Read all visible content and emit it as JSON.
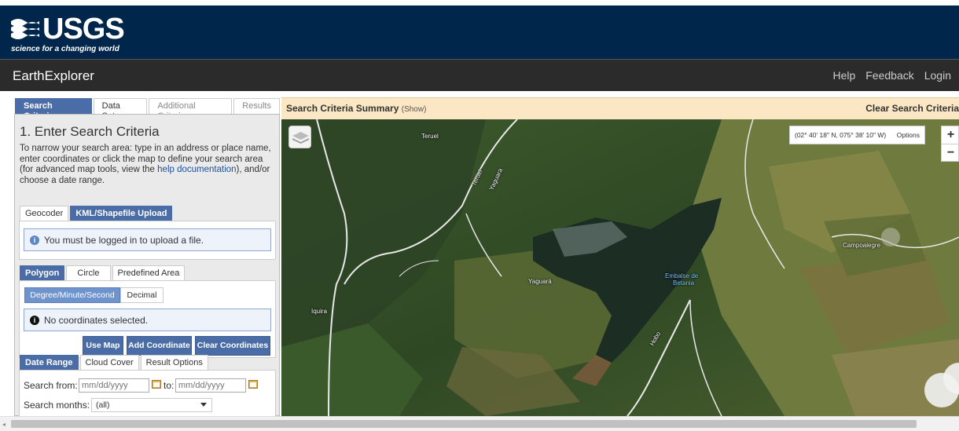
{
  "header": {
    "logo_word": "USGS",
    "logo_tagline": "science for a changing world",
    "app_title": "EarthExplorer",
    "nav_links": [
      "Help",
      "Feedback",
      "Login"
    ]
  },
  "main_tabs": [
    "Search Criteria",
    "Data Sets",
    "Additional Criteria",
    "Results"
  ],
  "search": {
    "heading": "1. Enter Search Criteria",
    "intro_before_link": "To narrow your search area: type in an address or place name, enter coordinates or click the map to define your search area (for advanced map tools, view the ",
    "intro_link": "help documentation",
    "intro_after_link": "), and/or choose a date range."
  },
  "geocoder_tabs": [
    "Geocoder",
    "KML/Shapefile Upload"
  ],
  "upload_message": "You must be logged in to upload a file.",
  "shape_tabs": [
    "Polygon",
    "Circle",
    "Predefined Area"
  ],
  "coord_format": [
    "Degree/Minute/Second",
    "Decimal"
  ],
  "coords_message": "No coordinates selected.",
  "coord_buttons": [
    "Use Map",
    "Add Coordinate",
    "Clear Coordinates"
  ],
  "date_tabs": [
    "Date Range",
    "Cloud Cover",
    "Result Options"
  ],
  "date_range": {
    "from_label": "Search from:",
    "from_placeholder": "mm/dd/yyyy",
    "to_label": "to:",
    "to_placeholder": "mm/dd/yyyy",
    "months_label": "Search months:",
    "months_value": "(all)"
  },
  "summary": {
    "title": "Search Criteria Summary",
    "show": "(Show)",
    "clear": "Clear Search Criteria"
  },
  "map": {
    "coordinates": "(02° 40' 18\" N, 075° 38' 10\" W)",
    "options": "Options",
    "zoom_in": "+",
    "zoom_out": "−",
    "labels": {
      "teruel": "Teruel",
      "road_1": "Teruel",
      "road_2": "Yaguara",
      "yaguara": "Yaguará",
      "embalse_1": "Embalse de",
      "embalse_2": "Betania",
      "campoalegre": "Campoalegre",
      "iquira": "Iquira",
      "hobo": "Hobo"
    }
  },
  "colors": {
    "header_navy": "#00264c",
    "accent_blue": "#4a6da7",
    "summary_bar": "#fbe7c4"
  }
}
